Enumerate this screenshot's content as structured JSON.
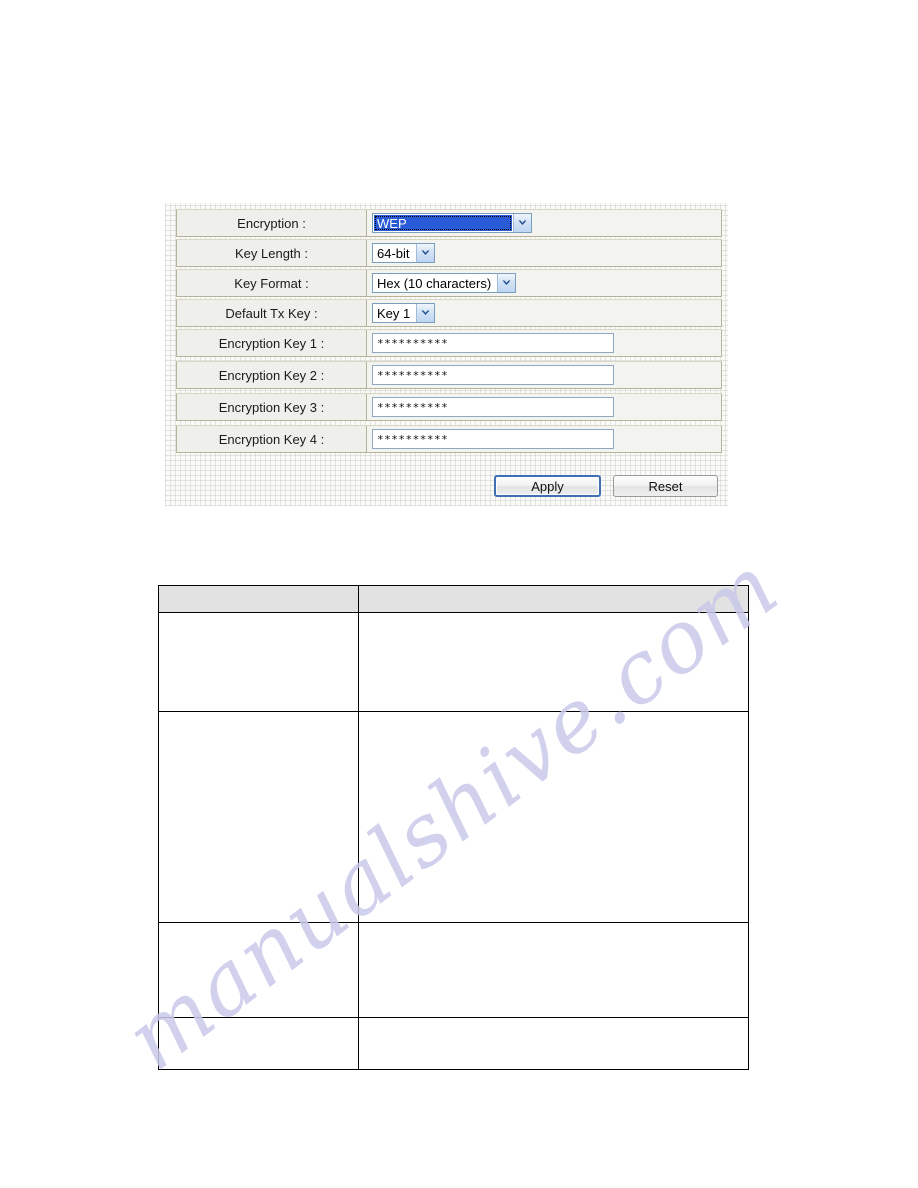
{
  "watermark": {
    "text": "manualshive.com"
  },
  "config_panel": {
    "rows": [
      {
        "label": "Encryption :",
        "control": "select",
        "value": "WEP",
        "state": "focused"
      },
      {
        "label": "Key Length :",
        "control": "select",
        "value": "64-bit",
        "state": "normal"
      },
      {
        "label": "Key Format :",
        "control": "select",
        "value": "Hex (10 characters)",
        "state": "normal"
      },
      {
        "label": "Default Tx Key :",
        "control": "select",
        "value": "Key 1",
        "state": "normal"
      },
      {
        "label": "Encryption Key 1 :",
        "control": "password",
        "value": "**********",
        "state": "normal"
      },
      {
        "label": "Encryption Key 2 :",
        "control": "password",
        "value": "**********",
        "state": "normal"
      },
      {
        "label": "Encryption Key 3 :",
        "control": "password",
        "value": "**********",
        "state": "normal"
      },
      {
        "label": "Encryption Key 4 :",
        "control": "password",
        "value": "**********",
        "state": "normal"
      }
    ],
    "buttons": {
      "apply": "Apply",
      "reset": "Reset"
    },
    "colors": {
      "selection_highlight": "#2a5bd7",
      "select_border": "#7b9ebd",
      "row_border": "#b6b49a",
      "default_button_outline": "#3f6fb5"
    }
  },
  "description_table": {
    "headers": [
      "",
      ""
    ],
    "rows": [
      {
        "cells": [
          "",
          ""
        ]
      },
      {
        "cells": [
          "",
          ""
        ]
      },
      {
        "cells": [
          "",
          ""
        ]
      },
      {
        "cells": [
          "",
          ""
        ]
      }
    ]
  }
}
